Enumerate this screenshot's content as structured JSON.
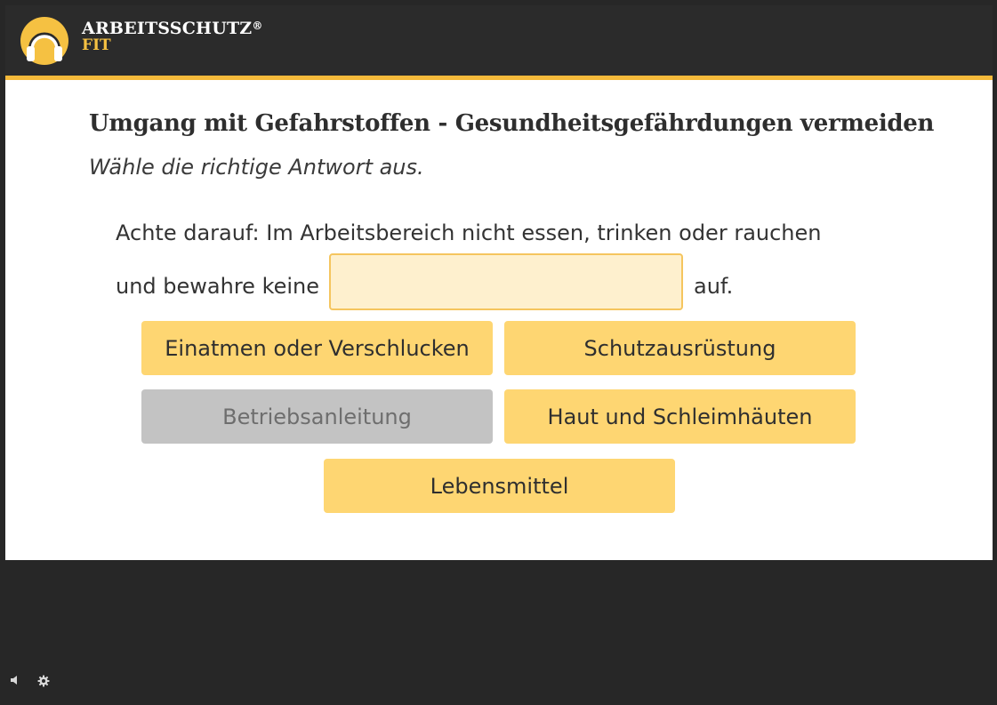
{
  "brand": {
    "line1": "ARBEITSSCHUTZ",
    "registered": "®",
    "line2": "FIT",
    "accent_color": "#f5b93a",
    "logo_icon": "headphones-icon"
  },
  "question": {
    "title": "Umgang mit Gefahrstoffen - Gesundheitsgefährdungen vermeiden",
    "instruction": "Wähle die richtige Antwort aus.",
    "sentence_line1": "Achte darauf: Im Arbeitsbereich nicht essen, trinken oder rauchen",
    "sentence_before_blank": "und bewahre keine",
    "sentence_after_blank": "auf.",
    "blank_value": ""
  },
  "options": [
    {
      "label": "Einatmen oder Verschlucken",
      "state": "available"
    },
    {
      "label": "Schutzausrüstung",
      "state": "available"
    },
    {
      "label": "Betriebsanleitung",
      "state": "disabled"
    },
    {
      "label": "Haut und Schleimhäuten",
      "state": "available"
    },
    {
      "label": "Lebensmittel",
      "state": "available"
    }
  ],
  "colors": {
    "option_bg": "#fed672",
    "option_disabled_bg": "#c3c3c3",
    "dropzone_bg": "#fef0ce",
    "dropzone_border": "#f5c55e",
    "background_dark": "#272727"
  },
  "controls": {
    "sound_icon": "speaker-icon",
    "settings_icon": "gear-icon"
  }
}
